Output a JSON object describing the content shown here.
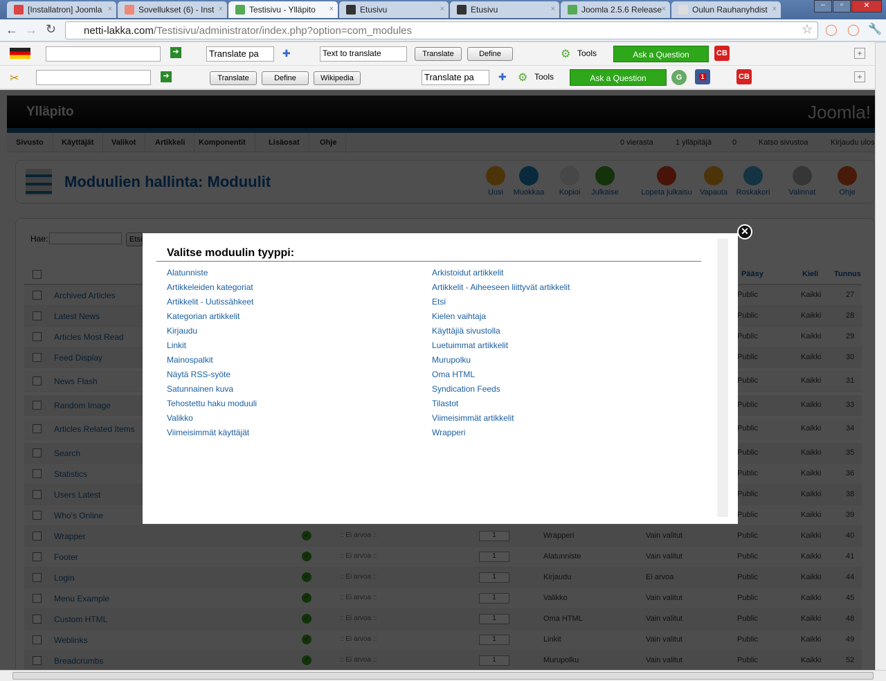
{
  "browser": {
    "tabs": [
      {
        "title": "[Installatron] Joomla",
        "icon": "gmail-icon",
        "color": "#d44"
      },
      {
        "title": "Sovellukset (6) - Inst",
        "icon": "cpanel-icon",
        "color": "#e87"
      },
      {
        "title": "Testisivu - Ylläpito",
        "icon": "joomla-icon",
        "color": "#5a5",
        "active": true
      },
      {
        "title": "Etusivu",
        "icon": "joomla-dark-icon",
        "color": "#333"
      },
      {
        "title": "Etusivu",
        "icon": "joomla-dark-icon",
        "color": "#333"
      },
      {
        "title": "Joomla 2.5.6 Release",
        "icon": "joomla-icon",
        "color": "#5a5"
      },
      {
        "title": "Oulun Rauhanyhdist",
        "icon": "page-icon",
        "color": "#ddd"
      }
    ],
    "url_domain": "netti-lakka.com",
    "url_path": "/Testisivu/administrator/index.php?option=com_modules"
  },
  "toolbar1": {
    "translate_select": "Translate pa",
    "text_input": "Text to translate",
    "translate": "Translate",
    "define": "Define",
    "tools": "Tools",
    "ask": "Ask a Question",
    "cb": "CB"
  },
  "toolbar2": {
    "translate": "Translate",
    "define": "Define",
    "wikipedia": "Wikipedia",
    "translate_select": "Translate pa",
    "tools": "Tools",
    "ask": "Ask a Question",
    "g": "G",
    "fb_badge": "1",
    "cb": "CB"
  },
  "admin": {
    "title": "Ylläpito",
    "logo": "Joomla!",
    "menu": [
      "Sivusto",
      "Käyttäjät",
      "Valikot",
      "Artikkeli",
      "Komponentit",
      "Lisäosat",
      "Ohje"
    ],
    "status": [
      "0 vierasta",
      "1 ylläpitäjä",
      "0",
      "Katso sivustoa",
      "Kirjaudu ulos"
    ],
    "page_title": "Moduulien hallinta: Moduulit",
    "toolbar": [
      {
        "label": "Uusi",
        "color": "#f0a020"
      },
      {
        "label": "Muokkaa",
        "color": "#2080c0"
      },
      {
        "label": "Kopioi",
        "color": "#ddd"
      },
      {
        "label": "Julkaise",
        "color": "#40a020"
      },
      {
        "label": "Lopeta julkaisu",
        "color": "#e04020"
      },
      {
        "label": "Vapauta",
        "color": "#f0a020"
      },
      {
        "label": "Roskakori",
        "color": "#40a0d0"
      },
      {
        "label": "Valinnat",
        "color": "#aaa"
      },
      {
        "label": "Ohje",
        "color": "#e05020"
      }
    ],
    "search_label": "Hae:",
    "search_button": "Etsi",
    "headers": {
      "access": "Pääsy",
      "language": "Kieli",
      "id": "Tunnus"
    },
    "rows": [
      {
        "title": "Archived Articles",
        "access": "Public",
        "lang": "Kaikki",
        "id": "27"
      },
      {
        "title": "Latest News",
        "access": "Public",
        "lang": "Kaikki",
        "id": "28"
      },
      {
        "title": "Articles Most Read",
        "access": "Public",
        "lang": "Kaikki",
        "id": "29"
      },
      {
        "title": "Feed Display",
        "access": "Public",
        "lang": "Kaikki",
        "id": "30"
      },
      {
        "title": "News Flash",
        "access": "Public",
        "lang": "Kaikki",
        "id": "31"
      },
      {
        "title": "Random Image",
        "access": "Public",
        "lang": "Kaikki",
        "id": "33"
      },
      {
        "title": "Articles Related Items",
        "access": "Public",
        "lang": "Kaikki",
        "id": "34"
      },
      {
        "title": "Search",
        "access": "Public",
        "lang": "Kaikki",
        "id": "35"
      },
      {
        "title": "Statistics",
        "access": "Public",
        "lang": "Kaikki",
        "id": "36"
      },
      {
        "title": "Users Latest",
        "access": "Public",
        "lang": "Kaikki",
        "id": "38"
      },
      {
        "title": "Who's Online",
        "access": "Public",
        "lang": "Kaikki",
        "id": "39"
      },
      {
        "title": "Wrapper",
        "position": ":: Ei arvoa ::",
        "order": "1",
        "type": "Wrapperi",
        "pages": "Vain valitut",
        "access": "Public",
        "lang": "Kaikki",
        "id": "40"
      },
      {
        "title": "Footer",
        "position": ":: Ei arvoa ::",
        "order": "1",
        "type": "Alatunniste",
        "pages": "Vain valitut",
        "access": "Public",
        "lang": "Kaikki",
        "id": "41"
      },
      {
        "title": "Login",
        "position": ":: Ei arvoa ::",
        "order": "1",
        "type": "Kirjaudu",
        "pages": "Ei arvoa",
        "access": "Public",
        "lang": "Kaikki",
        "id": "44"
      },
      {
        "title": "Menu Example",
        "position": ":: Ei arvoa ::",
        "order": "1",
        "type": "Valikko",
        "pages": "Vain valitut",
        "access": "Public",
        "lang": "Kaikki",
        "id": "45"
      },
      {
        "title": "Custom HTML",
        "position": ":: Ei arvoa ::",
        "order": "1",
        "type": "Oma HTML",
        "pages": "Vain valitut",
        "access": "Public",
        "lang": "Kaikki",
        "id": "48"
      },
      {
        "title": "Weblinks",
        "position": ":: Ei arvoa ::",
        "order": "1",
        "type": "Linkit",
        "pages": "Vain valitut",
        "access": "Public",
        "lang": "Kaikki",
        "id": "49"
      },
      {
        "title": "Breadcrumbs",
        "position": ":: Ei arvoa ::",
        "order": "1",
        "type": "Murupolku",
        "pages": "Vain valitut",
        "access": "Public",
        "lang": "Kaikki",
        "id": "52"
      }
    ]
  },
  "modal": {
    "title": "Valitse moduulin tyyppi:",
    "left": [
      "Alatunniste",
      "Artikkeleiden kategoriat",
      "Artikkelit - Uutissähkeet",
      "Kategorian artikkelit",
      "Kirjaudu",
      "Linkit",
      "Mainospalkit",
      "Näytä RSS-syöte",
      "Satunnainen kuva",
      "Tehostettu haku moduuli",
      "Valikko",
      "Viimeisimmät käyttäjät"
    ],
    "right": [
      "Arkistoidut artikkelit",
      "Artikkelit - Aiheeseen liittyvät artikkelit",
      "Etsi",
      "Kielen vaihtaja",
      "Käyttäjiä sivustolla",
      "Luetuimmat artikkelit",
      "Murupolku",
      "Oma HTML",
      "Syndication Feeds",
      "Tilastot",
      "Viimeisimmät artikkelit",
      "Wrapperi"
    ]
  }
}
